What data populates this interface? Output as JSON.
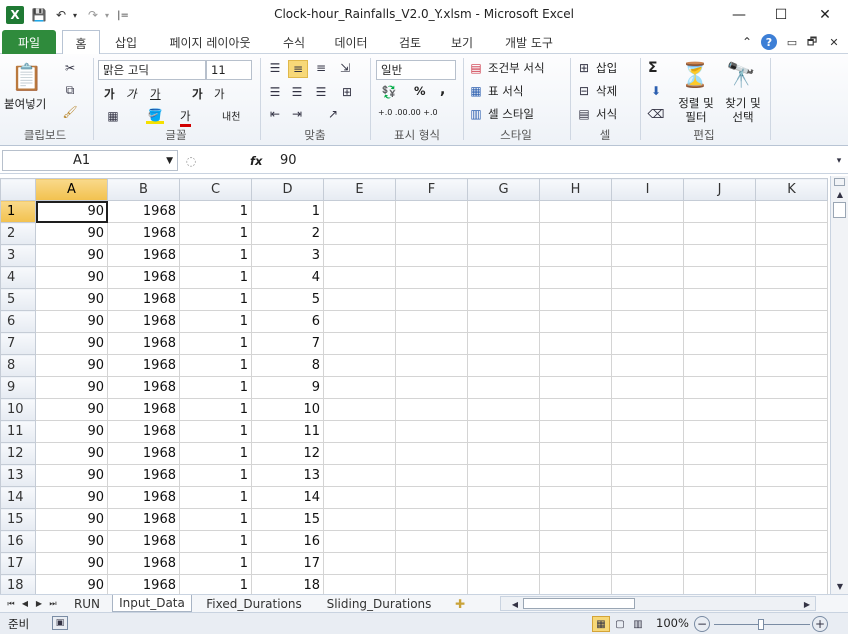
{
  "window": {
    "title": "Clock-hour_Rainfalls_V2.0_Y.xlsm  -  Microsoft Excel",
    "minimize": "—",
    "maximize": "☐",
    "close": "✕"
  },
  "qat": {
    "excel_logo": "X",
    "save": "💾",
    "undo": "↶",
    "redo": "↷",
    "customize": "|="
  },
  "tabs": [
    "파일",
    "홈",
    "삽입",
    "페이지 레이아웃",
    "수식",
    "데이터",
    "검토",
    "보기",
    "개발 도구"
  ],
  "ribbon_right": {
    "collapse": "⌃",
    "help": "?",
    "min": "▭",
    "restore": "🗗",
    "close": "✕"
  },
  "ribbon": {
    "clipboard": {
      "paste": "붙여넣기",
      "label": "클립보드"
    },
    "font": {
      "name": "맑은 고딕",
      "size": "11",
      "bold": "가",
      "italic": "가",
      "underline": "가",
      "grow": "가",
      "shrink": "가",
      "phonetic": "내천",
      "label": "글꼴"
    },
    "alignment": {
      "label": "맞춤"
    },
    "number": {
      "format": "일반",
      "percent": "%",
      "comma": ",",
      "inc": "+.0 .00",
      "dec": ".00 +.0",
      "label": "표시 형식"
    },
    "styles": {
      "conditional": "조건부 서식",
      "table": "표 서식",
      "cell": "셀 스타일",
      "label": "스타일"
    },
    "cells": {
      "insert": "삽입",
      "delete": "삭제",
      "format": "서식",
      "label": "셀"
    },
    "editing": {
      "sigma": "Σ",
      "sort": "정렬 및 필터",
      "find": "찾기 및 선택",
      "label": "편집"
    }
  },
  "formula_bar": {
    "name_box": "A1",
    "fx": "fx",
    "value": "90"
  },
  "columns": [
    "A",
    "B",
    "C",
    "D",
    "E",
    "F",
    "G",
    "H",
    "I",
    "J",
    "K"
  ],
  "rows": [
    [
      "90",
      "1968",
      "1",
      "1"
    ],
    [
      "90",
      "1968",
      "1",
      "2"
    ],
    [
      "90",
      "1968",
      "1",
      "3"
    ],
    [
      "90",
      "1968",
      "1",
      "4"
    ],
    [
      "90",
      "1968",
      "1",
      "5"
    ],
    [
      "90",
      "1968",
      "1",
      "6"
    ],
    [
      "90",
      "1968",
      "1",
      "7"
    ],
    [
      "90",
      "1968",
      "1",
      "8"
    ],
    [
      "90",
      "1968",
      "1",
      "9"
    ],
    [
      "90",
      "1968",
      "1",
      "10"
    ],
    [
      "90",
      "1968",
      "1",
      "11"
    ],
    [
      "90",
      "1968",
      "1",
      "12"
    ],
    [
      "90",
      "1968",
      "1",
      "13"
    ],
    [
      "90",
      "1968",
      "1",
      "14"
    ],
    [
      "90",
      "1968",
      "1",
      "15"
    ],
    [
      "90",
      "1968",
      "1",
      "16"
    ],
    [
      "90",
      "1968",
      "1",
      "17"
    ],
    [
      "90",
      "1968",
      "1",
      "18"
    ]
  ],
  "sheet_nav": [
    "⏮",
    "◀",
    "▶",
    "⏭"
  ],
  "sheets": [
    "RUN",
    "Input_Data",
    "Fixed_Durations",
    "Sliding_Durations"
  ],
  "active_sheet": "Input_Data",
  "status": {
    "ready": "준비",
    "zoom": "100%",
    "zoom_minus": "−",
    "zoom_plus": "+"
  },
  "colors": {
    "file_tab": "#2f8b3c",
    "selected_header": "#f2c14e",
    "ribbon": "#eef2f7"
  }
}
